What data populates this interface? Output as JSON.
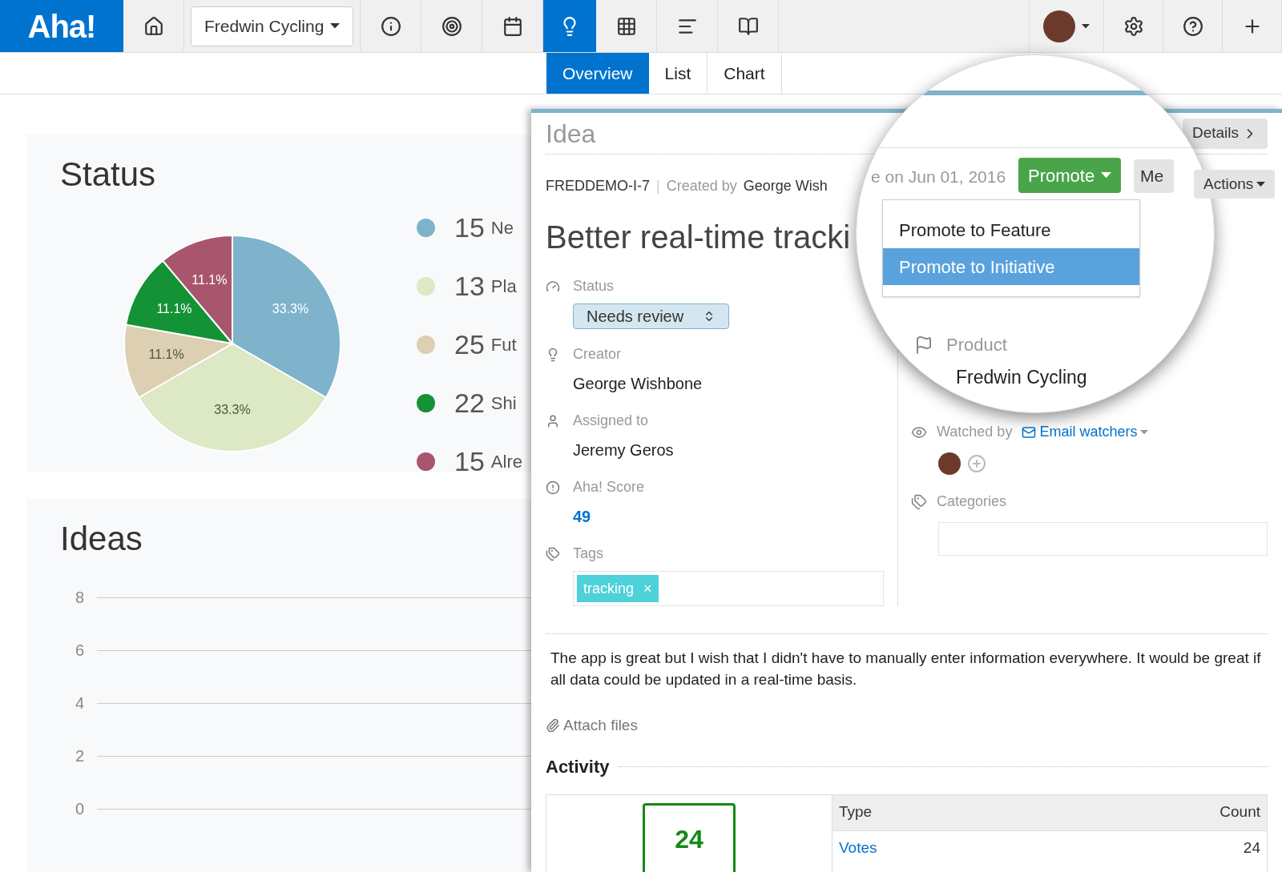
{
  "topbar": {
    "logo": "Aha!",
    "product": "Fredwin Cycling",
    "nav": [
      {
        "selected": false
      },
      {
        "selected": false
      },
      {
        "selected": false
      },
      {
        "selected": false
      },
      {
        "selected": true
      },
      {
        "selected": false
      },
      {
        "selected": false
      },
      {
        "selected": false
      }
    ]
  },
  "subtabs": [
    {
      "label": "Overview",
      "selected": true
    },
    {
      "label": "List",
      "selected": false
    },
    {
      "label": "Chart",
      "selected": false
    }
  ],
  "status_card": {
    "title": "Status",
    "chart_data": {
      "type": "pie",
      "values": [
        33.3,
        33.3,
        11.1,
        11.1,
        11.1
      ],
      "value_labels": [
        "33.3%",
        "33.3%",
        "11.1%",
        "11.1%",
        "11.1%"
      ]
    },
    "legend": [
      {
        "count": "15",
        "label": "Ne",
        "color": "#7fb3cb"
      },
      {
        "count": "13",
        "label": "Pla",
        "color": "#dde8c4"
      },
      {
        "count": "25",
        "label": "Fut",
        "color": "#dccfb2"
      },
      {
        "count": "22",
        "label": "Shi",
        "color": "#149236"
      },
      {
        "count": "15",
        "label": "Alre",
        "color": "#a8566e"
      }
    ]
  },
  "ideas_card": {
    "title": "Ideas",
    "y_ticks": [
      "8",
      "6",
      "4",
      "2",
      "0"
    ]
  },
  "idea": {
    "heading": "Idea",
    "ref": "FREDDEMO-I-7",
    "separator": "|",
    "created_label": "Created by",
    "creator": "George Wish",
    "date": "e on Jun 01, 2016",
    "title": "Better real-time tracki",
    "details_button": "Details",
    "more_button": "Me",
    "actions_button": "Actions",
    "promote_button": "Promote",
    "promote_menu": [
      {
        "label": "Promote to Feature",
        "selected": false
      },
      {
        "label": "Promote to Initiative",
        "selected": true
      }
    ],
    "fields": [
      {
        "kind": "select",
        "label": "Status",
        "value": "Needs review"
      },
      {
        "kind": "text",
        "label": "Creator",
        "value": "George Wishbone"
      },
      {
        "kind": "text",
        "label": "Assigned to",
        "value": "Jeremy Geros"
      },
      {
        "kind": "score",
        "label": "Aha! Score",
        "value": "49"
      },
      {
        "kind": "tags",
        "label": "Tags",
        "value": "tracking",
        "remove": "×"
      }
    ],
    "product_label": "Product",
    "product": "Fredwin Cycling",
    "watched_label": "Watched by",
    "email_watchers": "Email watchers",
    "categories_label": "Categories",
    "description": "The app is great but I wish that I didn't have to manually enter information everywhere. It would be great if all data could be updated in a real-time basis.",
    "attach": "Attach files",
    "activity": "Activity",
    "votes_total": "24",
    "table": {
      "columns": [
        "Type",
        "Count"
      ],
      "rows": [
        [
          "Votes",
          "24"
        ]
      ]
    }
  }
}
